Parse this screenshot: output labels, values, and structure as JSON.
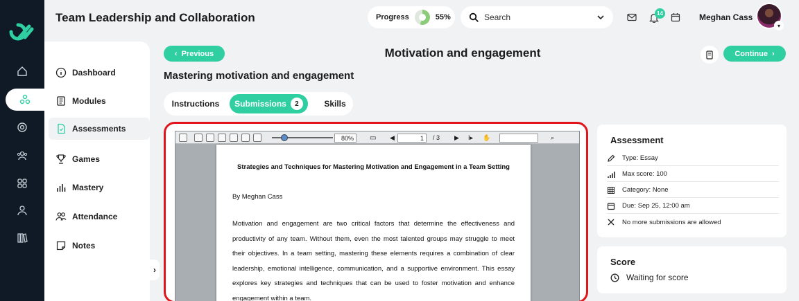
{
  "app": {
    "title": "Team Leadership and Collaboration"
  },
  "header": {
    "progress_label": "Progress",
    "progress_value": "55%",
    "progress_fraction": 0.55,
    "search_placeholder": "Search",
    "notification_count": "14",
    "user_name": "Meghan Cass"
  },
  "sidebar": {
    "items": [
      {
        "label": "Dashboard",
        "icon": "info-icon"
      },
      {
        "label": "Modules",
        "icon": "book-icon"
      },
      {
        "label": "Assessments",
        "icon": "document-icon",
        "active": true
      },
      {
        "label": "Games",
        "icon": "trophy-icon"
      },
      {
        "label": "Mastery",
        "icon": "bar-chart-icon"
      },
      {
        "label": "Attendance",
        "icon": "people-icon"
      },
      {
        "label": "Notes",
        "icon": "note-icon"
      }
    ]
  },
  "rail": {
    "icons": [
      "home-icon",
      "network-icon",
      "target-icon",
      "group-icon",
      "grid-icon",
      "user-icon",
      "books-icon"
    ]
  },
  "page": {
    "prev_label": "Previous",
    "title": "Motivation and engagement",
    "continue_label": "Continue",
    "subtitle": "Mastering motivation and engagement",
    "tabs": [
      {
        "label": "Instructions"
      },
      {
        "label": "Submissions",
        "count": "2",
        "active": true
      },
      {
        "label": "Skills"
      }
    ]
  },
  "viewer": {
    "zoom": "80%",
    "page_current": "1",
    "page_total": "/ 3",
    "document": {
      "title": "Strategies and Techniques for Mastering Motivation and Engagement in a Team Setting",
      "byline": "By Meghan Cass",
      "paragraph": "Motivation and engagement are two critical factors that determine the effectiveness and productivity of any team. Without them, even the most talented groups may struggle to meet their objectives. In a team setting, mastering these elements requires a combination of clear leadership, emotional intelligence, communication, and a supportive environment. This essay explores key strategies and techniques that can be used to foster motivation and enhance engagement within a team."
    }
  },
  "assessment": {
    "heading": "Assessment",
    "rows": [
      {
        "icon": "pencil-icon",
        "text": "Type: Essay"
      },
      {
        "icon": "signal-icon",
        "text": "Max score: 100"
      },
      {
        "icon": "grid-icon",
        "text": "Category: None"
      },
      {
        "icon": "calendar-icon",
        "text": "Due: Sep 25, 12:00 am"
      },
      {
        "icon": "close-icon",
        "text": "No more submissions are allowed"
      }
    ]
  },
  "score": {
    "heading": "Score",
    "status": "Waiting for score"
  },
  "colors": {
    "accent": "#2fcfa1",
    "rail": "#0f1a26",
    "highlight_border": "#e0151b"
  }
}
